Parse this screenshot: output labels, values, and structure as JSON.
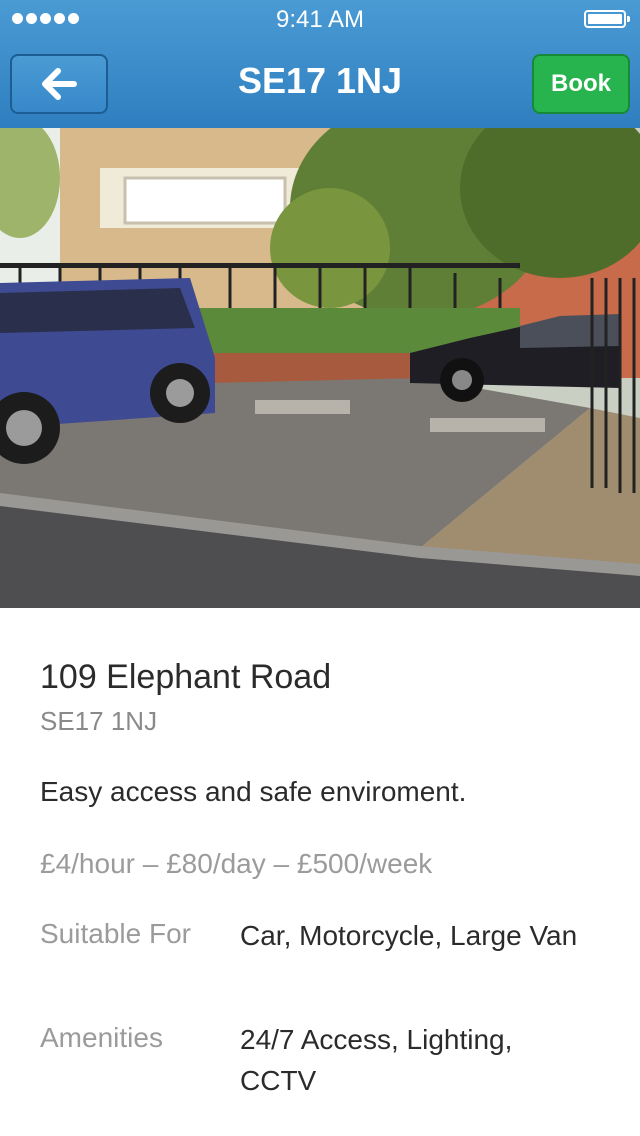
{
  "status_bar": {
    "time": "9:41 AM",
    "signal_dots": 5
  },
  "nav": {
    "title": "SE17 1NJ",
    "book_label": "Book",
    "back_icon": "arrow-left-icon"
  },
  "listing": {
    "photo_desc": "Parking space photo",
    "address": "109 Elephant Road",
    "postcode": "SE17 1NJ",
    "description": "Easy access and safe enviroment.",
    "prices": "£4/hour – £80/day – £500/week",
    "suitable_for_label": "Suitable For",
    "suitable_for_value": "Car, Motorcycle, Large Van",
    "amenities_label": "Amenities",
    "amenities_value": "24/7 Access, Lighting, CCTV"
  },
  "colors": {
    "header": "#3b8bcb",
    "book": "#27b44f",
    "text": "#2b2b2b",
    "muted": "#9b9b9b"
  }
}
